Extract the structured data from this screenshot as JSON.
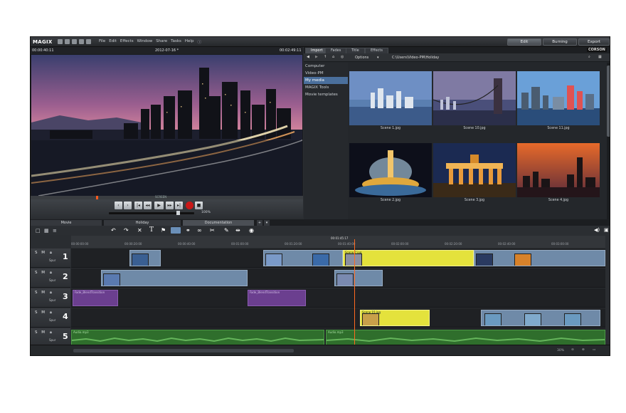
{
  "app": {
    "logo": "MAGIX",
    "menu": [
      "File",
      "Edit",
      "Effects",
      "Window",
      "Share",
      "Tasks",
      "Help"
    ],
    "modes": [
      {
        "label": "Edit",
        "active": true
      },
      {
        "label": "Burning",
        "active": false
      },
      {
        "label": "Export",
        "active": false
      }
    ]
  },
  "preview": {
    "timecode_left": "00:00:40:11",
    "date_title": "2012-07-16 *",
    "timecode_right": "00:02:49:11",
    "label": "SCREEN",
    "zoom": "100%"
  },
  "media": {
    "tabs": [
      "Import",
      "Fades",
      "Title",
      "Effects"
    ],
    "active_tab": "Import",
    "brand": "CORSON",
    "options_label": "Options",
    "path": "C:\\Users\\Video-PM\\Holiday",
    "tree": [
      "Computer",
      "Video-PM",
      "My media",
      "MAGIX Tools",
      "Movie templates"
    ],
    "tree_selected": "My media",
    "thumbs": [
      "Scene 1.jpg",
      "Scene 10.jpg",
      "Scene 11.jpg",
      "Scene 2.jpg",
      "Scene 3.jpg",
      "Scene 4.jpg"
    ]
  },
  "timeline": {
    "tabs": [
      "Movie",
      "Holiday",
      "Documentation"
    ],
    "active_tab": "Documentation",
    "ruler_marker": "00:01:45:17",
    "ruler_ticks": [
      "00:00:00:00",
      "00:00:20:00",
      "00:00:40:00",
      "00:01:00:00",
      "00:01:20:00",
      "00:01:40:00",
      "00:02:00:00",
      "00:02:20:00",
      "00:02:40:00",
      "00:03:00:00"
    ],
    "track_controls": "S M",
    "track_sublabel": "Spur",
    "track_numbers": [
      "1",
      "2",
      "3",
      "4",
      "5"
    ],
    "clip_labels": {
      "yellow1": "Scene 7.jpg",
      "purple1": "Fade_BlendTransition",
      "purple2": "Fade_BlendTransition",
      "yellow2": "Scene 15.jpg",
      "audio1": "Audio.mp3",
      "audio2": "Audio.mp3"
    },
    "zoom_status": "30%"
  }
}
